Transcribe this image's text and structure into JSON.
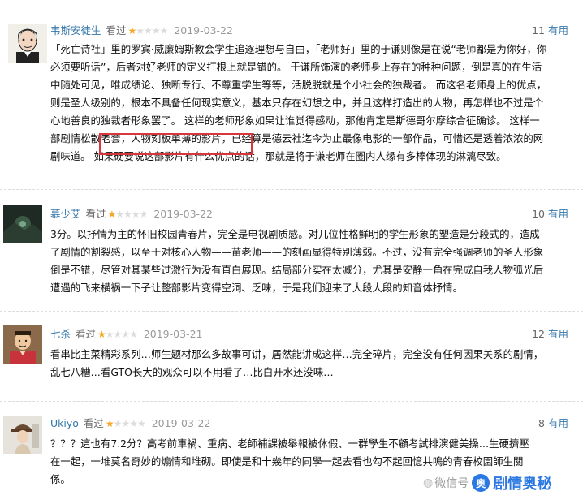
{
  "reviews": [
    {
      "author": "韦斯安徒生",
      "watched": "看过",
      "rating": 1,
      "date": "2019-03-22",
      "votes": "11",
      "useful": "有用",
      "avatar": "bald-man-portrait",
      "text": "「死亡诗社」里的罗宾·威廉姆斯教会学生追逐理想与自由，「老师好」里的于谦则像是在说“老师都是为你好，你必须要听话”，后者对好老师的定义打根上就是错的。 于谦所饰演的老师身上存在的种种问题，倒是真的在生活中随处可见，唯成绩论、独断专行、不尊重学生等等，活脱脱就是个小社会的独裁者。 而这名老师身上的优点，则是圣人级别的，根本不具备任何现实意义，基本只存在幻想之中，并且这样打造出的人物，再怎样也不过是个心地善良的独裁者形象罢了。 这样的老师形象如果让谁觉得感动，那他肯定是斯德哥尔摩综合征确诊。 这样一部剧情松散老套，人物刻板单薄的影片，已经算是德云社迄今为止最像电影的一部作品，可惜还是透着浓浓的网剧味道。 如果硬要说这部影片有什么优点的话，那就是将于谦老师在圈内人缘有多棒体现的淋漓尽致。"
    },
    {
      "author": "慕少艾",
      "watched": "看过",
      "rating": 1,
      "date": "2019-03-22",
      "votes": "10",
      "useful": "有用",
      "avatar": "dark-landscape",
      "text": "3分。以抒情为主的怀旧校园青春片，完全是电视剧质感。对几位性格鲜明的学生形象的塑造是分段式的，造成了剧情的割裂感，以至于对核心人物——苗老师——的刻画显得特别薄弱。不过，没有完全强调老师的圣人形象倒是不错，尽管对其某些过激行为没有直白展现。结局部分实在太减分，尤其是安静一角在完成自我人物弧光后遭遇的飞来横祸一下子让整部影片变得空洞、乏味，于是我们迎来了大段大段的知音体抒情。"
    },
    {
      "author": "七杀",
      "watched": "看过",
      "rating": 1,
      "date": "2019-03-21",
      "votes": "12",
      "useful": "有用",
      "avatar": "man-in-red-robe",
      "text": "看串比主菜精彩系列…师生题材那么多故事可讲，居然能讲成这样…完全碎片，完全没有任何因果关系的剧情，乱七八糟…看GTO长大的观众可以不用看了…比白开水还没味…"
    },
    {
      "author": "Ukiyo",
      "watched": "看过",
      "rating": 1,
      "date": "2019-03-22",
      "votes": "8",
      "useful": "有用",
      "avatar": "woman-with-hat",
      "text": "？？？這也有7.2分？高考前車禍、重病、老師補課被舉報被休假、一群學生不顧考試排演健美操…生硬擠壓在一起，一堆莫名奇妙的煽情和堆砌。即使是和十幾年的同學一起去看也勾不起回憶共鳴的青春校園師生關係。"
    }
  ],
  "highlight_text": "可惜还是透着浓浓的网剧味道。",
  "watermark": {
    "prefix": "微信号",
    "name": "剧情奥秘",
    "logo_char": "奥",
    "color": "#2b78e4"
  },
  "colors": {
    "author": "#3377aa",
    "star_on": "#f5a623",
    "star_off": "#dcdcdc",
    "highlight_border": "#d8363a"
  }
}
